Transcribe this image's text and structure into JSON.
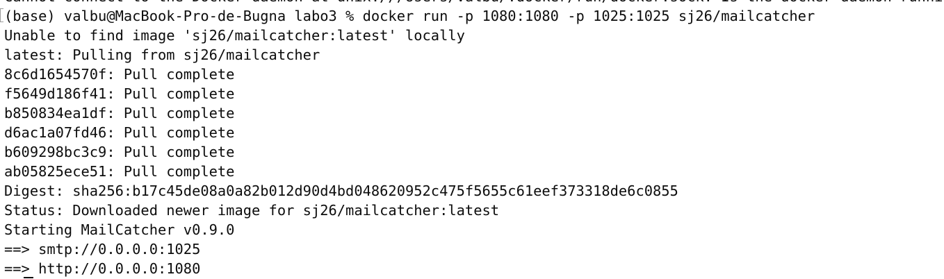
{
  "terminal": {
    "lines": [
      "Cannot connect to the Docker daemon at unix:///Users/valbu/.docker/run/docker.sock. Is the docker daemon running?",
      "(base) valbu@MacBook-Pro-de-Bugna labo3 % docker run -p 1080:1080 -p 1025:1025 sj26/mailcatcher",
      "Unable to find image 'sj26/mailcatcher:latest' locally",
      "latest: Pulling from sj26/mailcatcher",
      "8c6d1654570f: Pull complete",
      "f5649d186f41: Pull complete",
      "b850834ea1df: Pull complete",
      "d6ac1a07fd46: Pull complete",
      "b609298bc3c9: Pull complete",
      "ab05825ece51: Pull complete",
      "Digest: sha256:b17c45de08a0a82b012d90d4bd048620952c475f5655c61eef373318de6c0855",
      "Status: Downloaded newer image for sj26/mailcatcher:latest",
      "Starting MailCatcher v0.9.0",
      "==> smtp://0.0.0.0:1025",
      "==> http://0.0.0.0:1080"
    ]
  }
}
